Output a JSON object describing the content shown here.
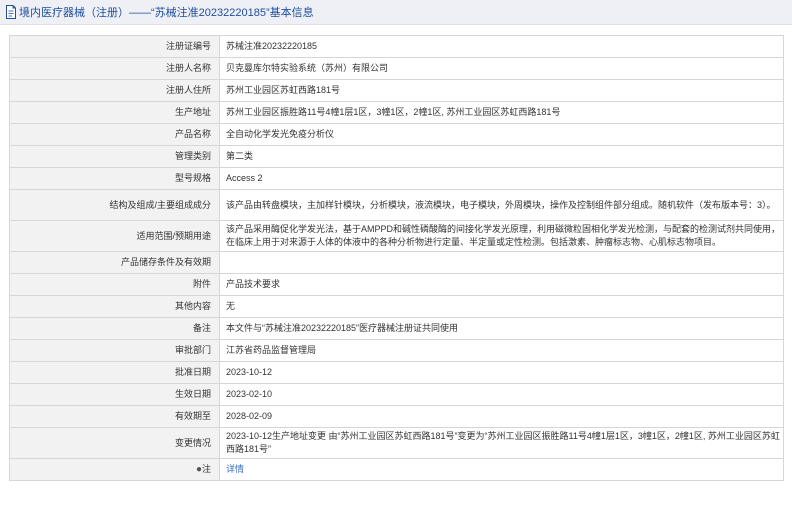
{
  "header": {
    "title": "境内医疗器械（注册）——“苏械注准20232220185”基本信息"
  },
  "rows": [
    {
      "label": "注册证编号",
      "value": "苏械注准20232220185"
    },
    {
      "label": "注册人名称",
      "value": "贝克曼库尔特实验系统（苏州）有限公司"
    },
    {
      "label": "注册人住所",
      "value": "苏州工业园区苏虹西路181号"
    },
    {
      "label": "生产地址",
      "value": "苏州工业园区振胜路11号4幢1层1区，3幢1区，2幢1区, 苏州工业园区苏虹西路181号"
    },
    {
      "label": "产品名称",
      "value": "全自动化学发光免疫分析仪"
    },
    {
      "label": "管理类别",
      "value": "第二类"
    },
    {
      "label": "型号规格",
      "value": "Access 2"
    },
    {
      "label": "结构及组成/主要组成成分",
      "value": "该产品由转盘模块，主加样针模块，分析模块，液流模块，电子模块，外周模块，操作及控制组件部分组成。随机软件（发布版本号：3）。"
    },
    {
      "label": "适用范围/预期用途",
      "value": "该产品采用酶促化学发光法，基于AMPPD和碱性磷酸酶的间接化学发光原理，利用磁微粒固相化学发光检测，与配套的检测试剂共同使用，在临床上用于对来源于人体的体液中的各种分析物进行定量、半定量或定性检测。包括激素、肿瘤标志物、心肌标志物项目。"
    },
    {
      "label": "产品储存条件及有效期",
      "value": ""
    },
    {
      "label": "附件",
      "value": "产品技术要求"
    },
    {
      "label": "其他内容",
      "value": "无"
    },
    {
      "label": "备注",
      "value": "本文件与“苏械注准20232220185”医疗器械注册证共同使用"
    },
    {
      "label": "审批部门",
      "value": "江苏省药品监督管理局"
    },
    {
      "label": "批准日期",
      "value": "2023-10-12"
    },
    {
      "label": "生效日期",
      "value": "2023-02-10"
    },
    {
      "label": "有效期至",
      "value": "2028-02-09"
    },
    {
      "label": "变更情况",
      "value": "2023-10-12生产地址变更 由“苏州工业园区苏虹西路181号”变更为“苏州工业园区振胜路11号4幢1层1区，3幢1区，2幢1区, 苏州工业园区苏虹西路181号”"
    }
  ],
  "footer_row": {
    "label": "注",
    "label_icon": "info-icon",
    "link_text": "详情"
  }
}
